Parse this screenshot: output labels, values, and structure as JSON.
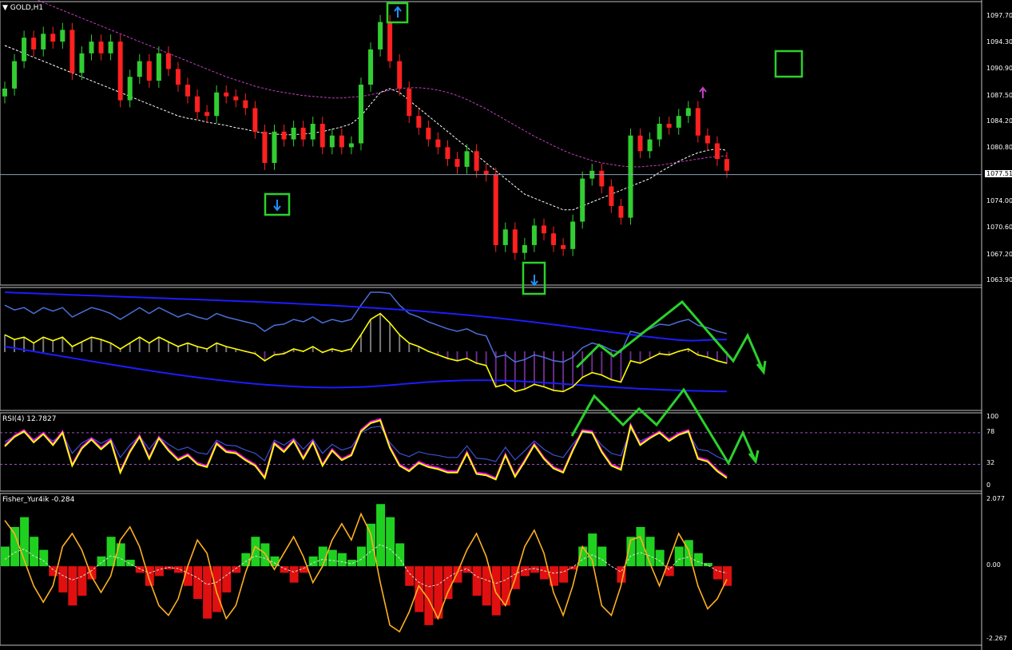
{
  "window": {
    "title": "GOLD,H1"
  },
  "colors": {
    "background": "#000000",
    "bull_candle": "#32cd32",
    "bear_candle": "#ff2020",
    "ma_fast": "#ffffff",
    "ma_slow": "#c040c0",
    "annotation": "#2bd12b",
    "arrow_up": "#1e90ff",
    "arrow_down_magenta": "#c040c0",
    "yellow_line": "#ffff00",
    "blue_line": "#1c1cff",
    "fisher_pos": "#20d020",
    "fisher_neg": "#e01010"
  },
  "chart_data": [
    {
      "type": "candlestick",
      "title": "GOLD,H1",
      "ylim": [
        1063.9,
        1099.0
      ],
      "y_ticks": [
        "1097.70",
        "1094.30",
        "1090.90",
        "1087.50",
        "1084.20",
        "1080.80",
        "1077.51",
        "1074.00",
        "1070.60",
        "1067.20",
        "1063.90"
      ],
      "current_price": "1077.51",
      "close": [
        1088.5,
        1092.0,
        1095.0,
        1093.5,
        1095.5,
        1094.5,
        1096.0,
        1090.5,
        1093.0,
        1094.5,
        1093.0,
        1094.5,
        1087.0,
        1090.0,
        1092.0,
        1089.5,
        1093.0,
        1091.0,
        1089.0,
        1087.5,
        1085.5,
        1085.0,
        1088.0,
        1087.5,
        1087.0,
        1086.0,
        1083.0,
        1079.0,
        1083.0,
        1082.0,
        1083.5,
        1082.0,
        1084.0,
        1081.0,
        1082.5,
        1081.0,
        1081.5,
        1089.0,
        1093.5,
        1097.0,
        1092.0,
        1088.5,
        1085.0,
        1083.5,
        1082.0,
        1081.0,
        1079.5,
        1078.5,
        1080.5,
        1078.0,
        1077.5,
        1068.5,
        1070.5,
        1067.5,
        1068.5,
        1071.0,
        1070.0,
        1068.5,
        1068.0,
        1071.5,
        1077.0,
        1078.0,
        1076.0,
        1073.5,
        1072.0,
        1082.5,
        1080.5,
        1082.0,
        1084.0,
        1083.5,
        1085.0,
        1086.0,
        1082.5,
        1081.5,
        1079.5,
        1078.0
      ],
      "ma_fast": [
        1094.0,
        1093.5,
        1093.0,
        1092.5,
        1092.0,
        1091.5,
        1091.0,
        1090.5,
        1090.0,
        1089.5,
        1089.0,
        1088.5,
        1088.0,
        1087.5,
        1087.0,
        1086.5,
        1086.0,
        1085.5,
        1085.0,
        1084.7,
        1084.5,
        1084.2,
        1084.0,
        1083.8,
        1083.5,
        1083.3,
        1083.0,
        1082.8,
        1082.7,
        1082.6,
        1082.6,
        1082.7,
        1082.8,
        1083.0,
        1083.3,
        1083.6,
        1084.0,
        1085.0,
        1086.5,
        1088.0,
        1088.5,
        1088.0,
        1087.0,
        1086.0,
        1085.0,
        1084.0,
        1083.0,
        1082.0,
        1081.0,
        1080.0,
        1079.0,
        1078.0,
        1077.0,
        1076.0,
        1075.0,
        1074.5,
        1074.0,
        1073.5,
        1073.0,
        1073.0,
        1073.5,
        1074.0,
        1074.5,
        1075.0,
        1075.5,
        1076.0,
        1076.5,
        1077.0,
        1077.8,
        1078.5,
        1079.2,
        1079.8,
        1080.3,
        1080.6,
        1080.8,
        1080.6
      ],
      "ma_slow": [
        1101.5,
        1101.0,
        1100.5,
        1100.0,
        1099.5,
        1099.0,
        1098.5,
        1098.0,
        1097.5,
        1097.0,
        1096.5,
        1096.0,
        1095.5,
        1095.0,
        1094.5,
        1094.0,
        1093.5,
        1093.0,
        1092.5,
        1092.0,
        1091.5,
        1091.0,
        1090.5,
        1090.0,
        1089.6,
        1089.2,
        1088.8,
        1088.5,
        1088.2,
        1088.0,
        1087.8,
        1087.6,
        1087.5,
        1087.4,
        1087.3,
        1087.3,
        1087.4,
        1087.5,
        1087.7,
        1088.0,
        1088.3,
        1088.5,
        1088.6,
        1088.6,
        1088.5,
        1088.3,
        1088.0,
        1087.6,
        1087.1,
        1086.5,
        1085.9,
        1085.2,
        1084.5,
        1083.8,
        1083.1,
        1082.4,
        1081.8,
        1081.2,
        1080.6,
        1080.1,
        1079.7,
        1079.3,
        1079.0,
        1078.8,
        1078.6,
        1078.5,
        1078.5,
        1078.6,
        1078.7,
        1078.9,
        1079.1,
        1079.3,
        1079.5,
        1079.7,
        1079.8,
        1079.9
      ]
    },
    {
      "type": "line",
      "title": "",
      "series": [
        {
          "values": [
            0.62,
            0.58,
            0.6,
            0.55,
            0.6,
            0.57,
            0.6,
            0.52,
            0.56,
            0.6,
            0.58,
            0.55,
            0.5,
            0.55,
            0.6,
            0.55,
            0.6,
            0.56,
            0.52,
            0.55,
            0.52,
            0.5,
            0.55,
            0.52,
            0.5,
            0.48,
            0.46,
            0.4,
            0.45,
            0.46,
            0.5,
            0.48,
            0.52,
            0.47,
            0.5,
            0.48,
            0.5,
            0.62,
            0.75,
            0.8,
            0.72,
            0.62,
            0.55,
            0.52,
            0.48,
            0.45,
            0.42,
            0.4,
            0.42,
            0.38,
            0.36,
            0.18,
            0.2,
            0.14,
            0.16,
            0.2,
            0.18,
            0.15,
            0.14,
            0.18,
            0.26,
            0.3,
            0.28,
            0.24,
            0.22,
            0.4,
            0.38,
            0.42,
            0.46,
            0.45,
            0.48,
            0.5,
            0.45,
            0.43,
            0.4,
            0.38
          ]
        }
      ]
    },
    {
      "type": "line",
      "title": "RSI(4) 12.7827",
      "y_ticks": [
        "100",
        "78",
        "32",
        "0"
      ],
      "ylim": [
        0,
        100
      ],
      "series": [
        {
          "values": [
            58,
            72,
            80,
            64,
            76,
            60,
            78,
            30,
            55,
            68,
            54,
            66,
            20,
            50,
            72,
            40,
            70,
            52,
            38,
            45,
            32,
            28,
            62,
            50,
            48,
            38,
            30,
            12,
            62,
            50,
            66,
            40,
            64,
            30,
            52,
            38,
            45,
            80,
            92,
            96,
            56,
            30,
            22,
            34,
            28,
            25,
            20,
            20,
            48,
            18,
            16,
            10,
            45,
            14,
            36,
            60,
            40,
            26,
            20,
            52,
            80,
            78,
            50,
            30,
            24,
            88,
            60,
            70,
            78,
            66,
            75,
            80,
            40,
            36,
            22,
            12
          ]
        }
      ]
    },
    {
      "type": "bar",
      "title": "Fisher_Yur4ik -0.284",
      "y_ticks": [
        "2.077",
        "0.00",
        "-2.267"
      ],
      "ylim": [
        -2.267,
        2.077
      ],
      "values": [
        0.6,
        1.2,
        1.5,
        0.9,
        0.5,
        -0.3,
        -0.8,
        -1.2,
        -0.9,
        -0.4,
        0.3,
        0.9,
        0.7,
        0.2,
        -0.2,
        -0.6,
        -0.3,
        -0.1,
        -0.2,
        -0.6,
        -1.0,
        -1.6,
        -1.4,
        -0.8,
        -0.2,
        0.4,
        0.9,
        0.7,
        0.3,
        -0.2,
        -0.5,
        -0.2,
        0.3,
        0.6,
        0.5,
        0.4,
        0.2,
        0.6,
        1.3,
        1.9,
        1.5,
        0.7,
        -0.6,
        -1.4,
        -1.8,
        -1.6,
        -1.0,
        -0.5,
        -0.2,
        -0.9,
        -1.2,
        -1.5,
        -1.2,
        -0.7,
        -0.3,
        -0.2,
        -0.4,
        -0.6,
        -0.5,
        -0.1,
        0.6,
        1.0,
        0.6,
        0.0,
        -0.5,
        0.9,
        1.2,
        0.9,
        0.5,
        -0.3,
        0.6,
        0.8,
        0.4,
        0.1,
        -0.4,
        -0.6
      ],
      "signal": [
        1.4,
        1.0,
        0.2,
        -0.6,
        -1.1,
        -0.6,
        0.6,
        1.0,
        0.5,
        -0.3,
        -0.8,
        -0.3,
        0.8,
        1.2,
        0.6,
        -0.4,
        -1.2,
        -1.5,
        -1.0,
        0.0,
        0.8,
        0.4,
        -0.8,
        -1.6,
        -1.2,
        -0.2,
        0.6,
        0.4,
        -0.1,
        0.4,
        0.9,
        0.3,
        -0.5,
        0.0,
        0.8,
        1.3,
        0.8,
        1.6,
        1.0,
        -0.5,
        -1.8,
        -2.0,
        -1.4,
        -0.6,
        -1.0,
        -1.6,
        -0.8,
        -0.2,
        0.5,
        1.0,
        0.3,
        -0.8,
        -1.2,
        -0.4,
        0.6,
        1.1,
        0.4,
        -0.8,
        -1.5,
        -0.6,
        0.6,
        0.2,
        -1.2,
        -1.5,
        -0.6,
        0.8,
        0.9,
        0.1,
        -0.6,
        0.2,
        1.0,
        0.5,
        -0.6,
        -1.3,
        -1.0,
        -0.4
      ]
    }
  ]
}
